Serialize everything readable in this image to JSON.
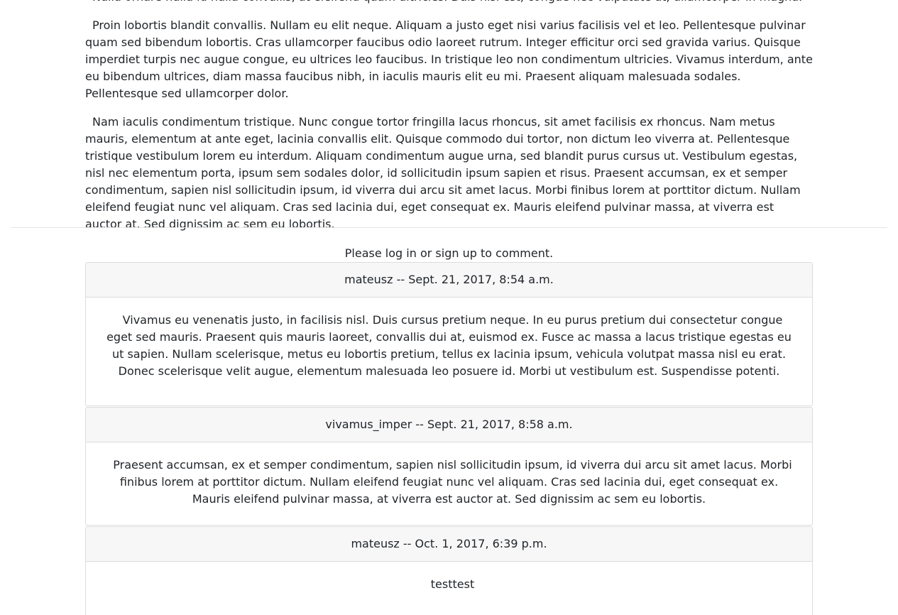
{
  "article": {
    "top_partial": "Nulla ornare nulla id nulla convallis, at eleifend quam ultricies. Duis nisi est, congue nec vulputate at, ullamcorper in magna.",
    "paragraphs": [
      "Proin lobortis blandit convallis. Nullam eu elit neque. Aliquam a justo eget nisi varius facilisis vel et leo. Pellentesque pulvinar quam sed bibendum lobortis. Cras ullamcorper faucibus odio laoreet rutrum. Integer efficitur orci sed gravida varius. Quisque imperdiet turpis nec augue congue, eu ultrices leo faucibus. In tristique leo non condimentum ultricies. Vivamus interdum, ante eu bibendum ultrices, diam massa faucibus nibh, in iaculis mauris elit eu mi. Praesent aliquam malesuada sodales. Pellentesque sed ullamcorper dolor.",
      "Nam iaculis condimentum tristique. Nunc congue tortor fringilla lacus rhoncus, sit amet facilisis ex rhoncus. Nam metus mauris, elementum at ante eget, lacinia convallis elit. Quisque commodo dui tortor, non dictum leo viverra at. Pellentesque tristique vestibulum lorem eu interdum. Aliquam condimentum augue urna, sed blandit purus cursus ut. Vestibulum egestas, nisl nec elementum porta, ipsum sem sodales dolor, id sollicitudin ipsum sapien et risus. Praesent accumsan, ex et semper condimentum, sapien nisl sollicitudin ipsum, id viverra dui arcu sit amet lacus. Morbi finibus lorem at porttitor dictum. Nullam eleifend feugiat nunc vel aliquam. Cras sed lacinia dui, eget consequat ex. Mauris eleifend pulvinar massa, at viverra est auctor at. Sed dignissim ac sem eu lobortis."
    ]
  },
  "login_prompt": {
    "prefix": "Please ",
    "login_link": "log in",
    "middle": " or ",
    "signup_link": "sign up",
    "suffix": " to comment."
  },
  "comments": [
    {
      "header": "mateusz -- Sept. 21, 2017, 8:54 a.m.",
      "body": "Vivamus eu venenatis justo, in facilisis nisl. Duis cursus pretium neque. In eu purus pretium dui consectetur congue eget sed mauris. Praesent quis mauris laoreet, convallis dui at, euismod ex. Fusce ac massa a lacus tristique egestas eu ut sapien. Nullam scelerisque, metus eu lobortis pretium, tellus ex lacinia ipsum, vehicula volutpat massa nisl eu erat. Donec scelerisque velit augue, elementum malesuada leo posuere id. Morbi ut vestibulum est. Suspendisse potenti."
    },
    {
      "header": "vivamus_imper -- Sept. 21, 2017, 8:58 a.m.",
      "body": "Praesent accumsan, ex et semper condimentum, sapien nisl sollicitudin ipsum, id viverra dui arcu sit amet lacus. Morbi finibus lorem at porttitor dictum. Nullam eleifend feugiat nunc vel aliquam. Cras sed lacinia dui, eget consequat ex. Mauris eleifend pulvinar massa, at viverra est auctor at. Sed dignissim ac sem eu lobortis."
    },
    {
      "header": "mateusz -- Oct. 1, 2017, 6:39 p.m.",
      "body": "testtest"
    }
  ]
}
